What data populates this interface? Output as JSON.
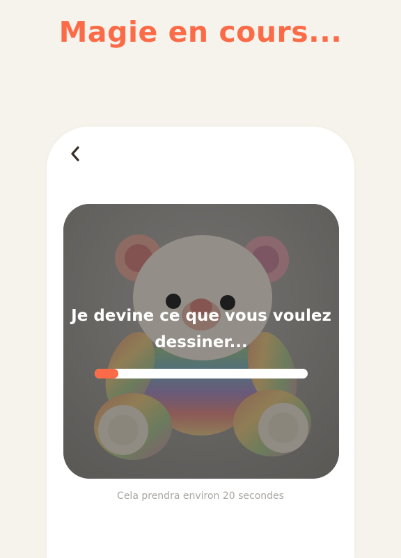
{
  "headline": "Magie en cours...",
  "screen": {
    "back_icon": "chevron-left-icon",
    "loading_text": "Je devine ce que vous voulez dessiner...",
    "progress": 0.11,
    "hint": "Cela prendra environ 20 secondes"
  },
  "colors": {
    "accent": "#fc6b47",
    "background": "#f6f3ec",
    "card": "#ffffff",
    "hint_text": "#a9a6a1"
  }
}
